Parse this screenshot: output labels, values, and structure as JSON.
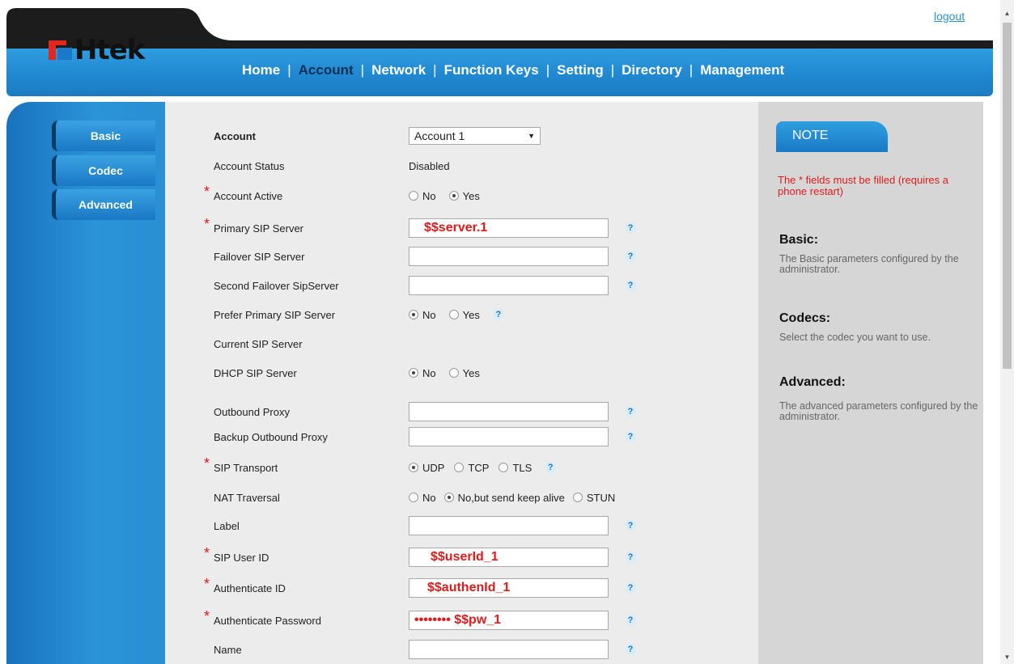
{
  "header": {
    "logout": "logout",
    "logo": "Htek",
    "nav": [
      {
        "label": "Home"
      },
      {
        "label": "Account"
      },
      {
        "label": "Network"
      },
      {
        "label": "Function Keys"
      },
      {
        "label": "Setting"
      },
      {
        "label": "Directory"
      },
      {
        "label": "Management"
      }
    ],
    "active_nav": "Account"
  },
  "sidebar": {
    "items": [
      {
        "label": "Basic"
      },
      {
        "label": "Codec"
      },
      {
        "label": "Advanced"
      }
    ]
  },
  "form": {
    "heading": "Account",
    "account_select": "Account 1",
    "account_status_label": "Account Status",
    "account_status_value": "Disabled",
    "account_active_label": "Account Active",
    "primary_sip_label": "Primary SIP Server",
    "primary_sip_value": "$$server.1",
    "failover_sip_label": "Failover SIP Server",
    "second_failover_label": "Second Failover SipServer",
    "prefer_primary_label": "Prefer Primary SIP Server",
    "current_sip_label": "Current SIP Server",
    "dhcp_sip_label": "DHCP SIP Server",
    "outbound_proxy_label": "Outbound Proxy",
    "backup_outbound_label": "Backup Outbound Proxy",
    "sip_transport_label": "SIP Transport",
    "nat_traversal_label": "NAT Traversal",
    "label_label": "Label",
    "sip_user_id_label": "SIP User ID",
    "sip_user_id_value": "$$userId_1",
    "auth_id_label": "Authenticate ID",
    "auth_id_value": "$$authenId_1",
    "auth_pw_label": "Authenticate Password",
    "auth_pw_value": "•••••••• $$pw_1",
    "name_label": "Name",
    "opt_no": "No",
    "opt_yes": "Yes",
    "opt_udp": "UDP",
    "opt_tcp": "TCP",
    "opt_tls": "TLS",
    "opt_keepalive": "No,but send keep alive",
    "opt_stun": "STUN",
    "help_glyph": "?"
  },
  "note": {
    "title": "NOTE",
    "required": "The * fields must be filled (requires a phone restart)",
    "basic_h": "Basic:",
    "basic_p": "The Basic parameters configured by the administrator.",
    "codecs_h": "Codecs:",
    "codecs_p": "Select the codec you want to use.",
    "advanced_h": "Advanced:",
    "advanced_p": "The advanced parameters configured by the administrator."
  },
  "colors": {
    "brand_blue": "#1f86cf",
    "required_red": "#e01b1b",
    "logo_red": "#e0281e"
  }
}
